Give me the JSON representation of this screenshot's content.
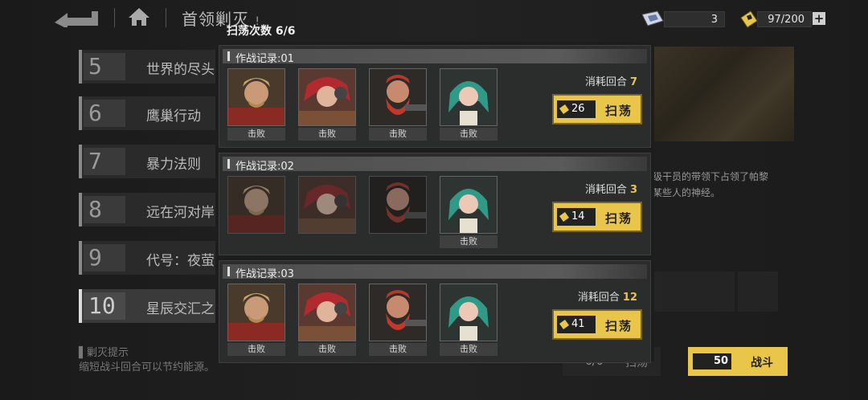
{
  "header": {
    "title": "首领剿灭",
    "title_mark": "!"
  },
  "resources": {
    "gem_count": "3",
    "stamina": "97/200",
    "plus": "+"
  },
  "stages": [
    {
      "num": "5",
      "name": "世界的尽头"
    },
    {
      "num": "6",
      "name": "鹰巢行动"
    },
    {
      "num": "7",
      "name": "暴力法则"
    },
    {
      "num": "8",
      "name": "远在河对岸"
    },
    {
      "num": "9",
      "name": "代号：夜萤"
    },
    {
      "num": "10",
      "name": "星辰交汇之"
    }
  ],
  "hint": {
    "title": "剿灭提示",
    "text": "缩短战斗回合可以节约能源。"
  },
  "detail": {
    "description_line1": "级干员的带领下占领了帕黎",
    "description_line2": "某些人的神经。",
    "bottom_sweep_count": "6/6",
    "bottom_sweep_label": "扫荡",
    "fight_cost": "50",
    "fight_label": "战斗"
  },
  "dialog": {
    "title": "扫荡次数 6/6",
    "records": [
      {
        "label": "作战记录:01",
        "turns_label": "消耗回合",
        "turns": "7",
        "cost": "26",
        "sweep_label": "扫荡",
        "defeated": [
          true,
          true,
          true,
          true
        ],
        "defeat_text": "击败"
      },
      {
        "label": "作战记录:02",
        "turns_label": "消耗回合",
        "turns": "3",
        "cost": "14",
        "sweep_label": "扫荡",
        "defeated": [
          false,
          false,
          false,
          true
        ],
        "defeat_text": "击败"
      },
      {
        "label": "作战记录:03",
        "turns_label": "消耗回合",
        "turns": "12",
        "cost": "41",
        "sweep_label": "扫荡",
        "defeated": [
          true,
          true,
          true,
          true
        ],
        "defeat_text": "击败"
      }
    ]
  },
  "colors": {
    "accent": "#e9c64a",
    "panel": "#2b2c2c",
    "background": "#121212"
  },
  "icons": [
    "back-arrow-icon",
    "home-icon",
    "gem-ticket-icon",
    "energy-ticket-icon",
    "plus-icon"
  ]
}
